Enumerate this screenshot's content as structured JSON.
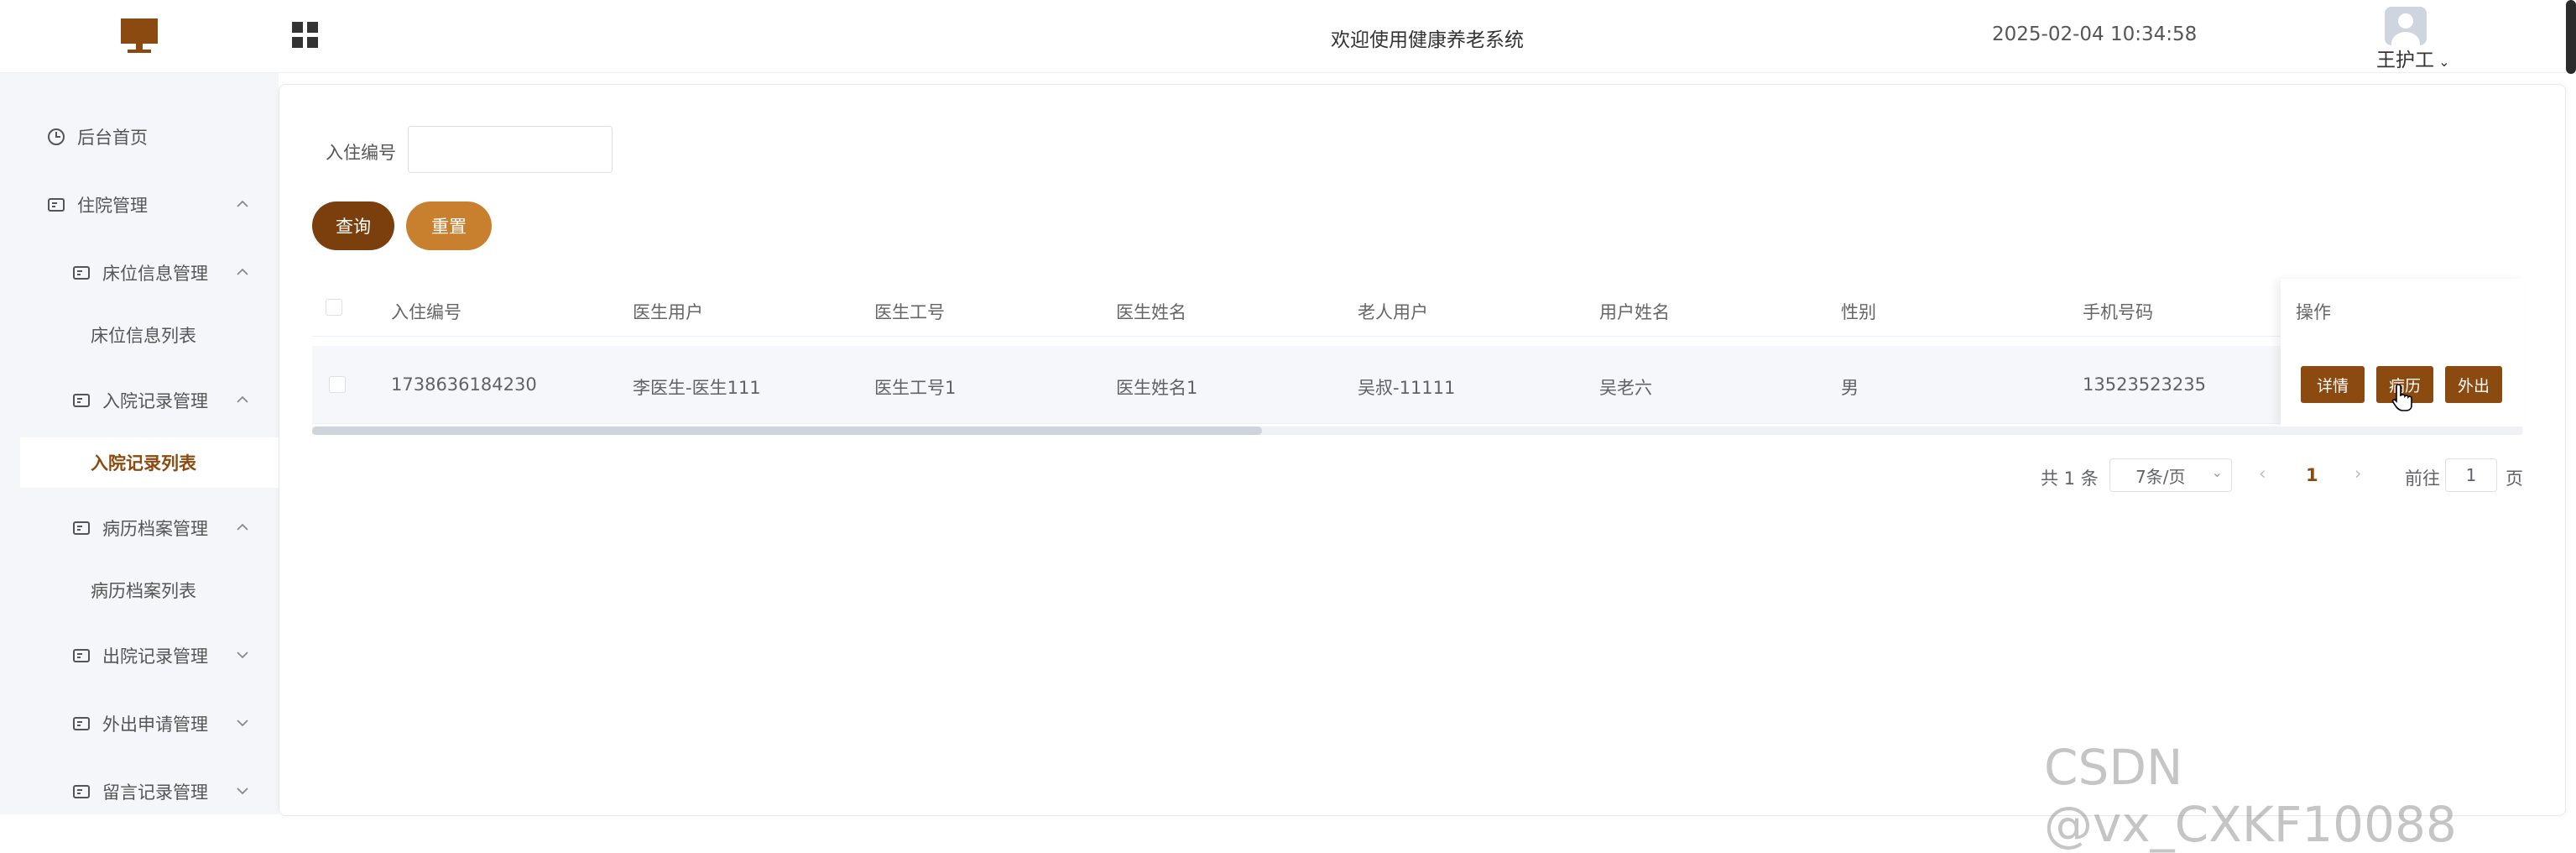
{
  "header": {
    "welcome": "欢迎使用健康养老系统",
    "datetime": "2025-02-04 10:34:58",
    "user": "王护工"
  },
  "sidebar": {
    "items": [
      {
        "label": "后台首页"
      },
      {
        "label": "住院管理"
      },
      {
        "label": "床位信息管理"
      },
      {
        "label": "床位信息列表"
      },
      {
        "label": "入院记录管理"
      },
      {
        "label": "入院记录列表"
      },
      {
        "label": "病历档案管理"
      },
      {
        "label": "病历档案列表"
      },
      {
        "label": "出院记录管理"
      },
      {
        "label": "外出申请管理"
      },
      {
        "label": "留言记录管理"
      }
    ]
  },
  "search": {
    "label": "入住编号",
    "value": "",
    "query_label": "查询",
    "reset_label": "重置"
  },
  "table": {
    "headers": [
      "入住编号",
      "医生用户",
      "医生工号",
      "医生姓名",
      "老人用户",
      "用户姓名",
      "性别",
      "手机号码",
      "操作"
    ],
    "rows": [
      [
        "1738636184230",
        "李医生-医生111",
        "医生工号1",
        "医生姓名1",
        "吴叔-11111",
        "吴老六",
        "男",
        "13523523235"
      ]
    ],
    "actions": [
      "详情",
      "病历",
      "外出"
    ]
  },
  "pagination": {
    "total": "共 1 条",
    "page_size": "7条/页",
    "current": "1",
    "goto_prefix": "前往",
    "goto_value": "1",
    "goto_suffix": "页"
  },
  "watermark": "CSDN @vx_CXKF10088",
  "colors": {
    "accent": "#8b4a0f",
    "query": "#7a3f0c",
    "reset": "#c8802f"
  }
}
